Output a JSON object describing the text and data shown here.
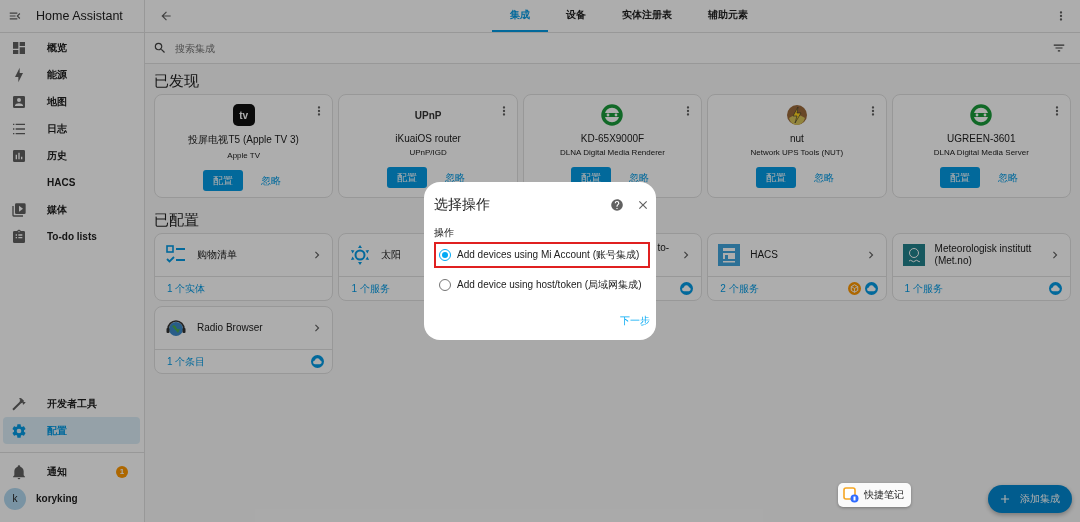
{
  "sidebar": {
    "title": "Home Assistant",
    "items": [
      {
        "label": "概览",
        "selected": false
      },
      {
        "label": "能源",
        "selected": false
      },
      {
        "label": "地图",
        "selected": false
      },
      {
        "label": "日志",
        "selected": false
      },
      {
        "label": "历史",
        "selected": false
      },
      {
        "label": "HACS",
        "selected": false
      },
      {
        "label": "媒体",
        "selected": false
      },
      {
        "label": "To-do lists",
        "selected": false
      }
    ],
    "bottom_items": [
      {
        "label": "开发者工具",
        "selected": false
      },
      {
        "label": "配置",
        "selected": true
      }
    ],
    "notifications": {
      "label": "通知",
      "badge": "1"
    },
    "user": {
      "initial": "k",
      "name": "koryking"
    }
  },
  "tabs": [
    {
      "label": "集成",
      "selected": true
    },
    {
      "label": "设备",
      "selected": false
    },
    {
      "label": "实体注册表",
      "selected": false
    },
    {
      "label": "辅助元素",
      "selected": false
    }
  ],
  "search": {
    "placeholder": "搜索集成"
  },
  "discovered": {
    "title": "已发现",
    "cards": [
      {
        "name": "投屏电视T5 (Apple TV 3)",
        "subtitle": "Apple TV",
        "logo_text": "tv",
        "configure": "配置",
        "ignore": "忽略"
      },
      {
        "name": "iKuaiOS router",
        "subtitle": "UPnP/IGD",
        "logo_text": "UPnP",
        "configure": "配置",
        "ignore": "忽略"
      },
      {
        "name": "KD-65X9000F",
        "subtitle": "DLNA Digital Media Renderer",
        "configure": "配置",
        "ignore": "忽略"
      },
      {
        "name": "nut",
        "subtitle": "Network UPS Tools (NUT)",
        "configure": "配置",
        "ignore": "忽略"
      },
      {
        "name": "UGREEN-3601",
        "subtitle": "DLNA Digital Media Server",
        "configure": "配置",
        "ignore": "忽略"
      }
    ]
  },
  "configured": {
    "title": "已配置",
    "cards": [
      {
        "name": "购物清单",
        "footer": "1 个实体"
      },
      {
        "name": "太阳",
        "footer": "1 个服务"
      },
      {
        "name": "to-"
      },
      {
        "name": "HACS",
        "footer": "2 个服务"
      },
      {
        "name": "Meteorologisk institutt (Met.no)",
        "footer": "1 个服务"
      },
      {
        "name": "Radio Browser",
        "footer": "1 个条目"
      }
    ]
  },
  "dialog": {
    "title": "选择操作",
    "field_label": "操作",
    "options": [
      {
        "label": "Add devices using Mi Account (账号集成)",
        "selected": true,
        "highlighted": true
      },
      {
        "label": "Add device using host/token (局域网集成)",
        "selected": false,
        "highlighted": false
      }
    ],
    "next": "下一步"
  },
  "fab": {
    "label": "添加集成"
  },
  "quick_note": {
    "label": "快捷笔记"
  }
}
